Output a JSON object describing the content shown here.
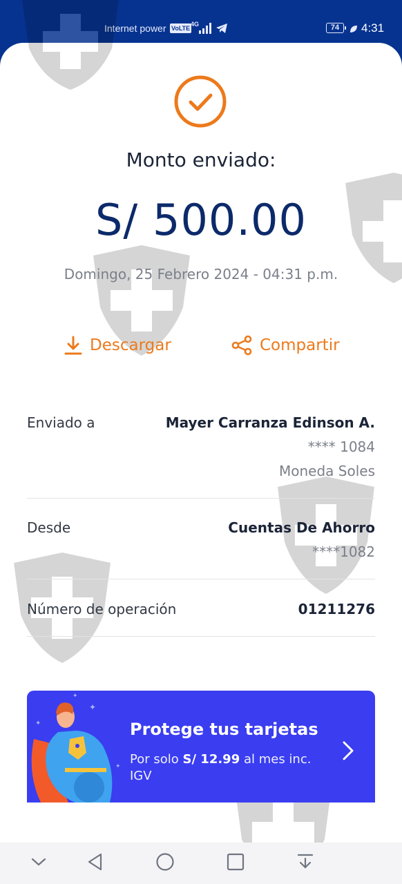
{
  "status_bar": {
    "carrier": "Internet power",
    "volte": "VoLTE",
    "network": "4G",
    "battery": "74",
    "time": "4:31"
  },
  "receipt": {
    "title": "Monto enviado:",
    "amount": "S/ 500.00",
    "datetime": "Domingo, 25 Febrero 2024 - 04:31 p.m."
  },
  "actions": {
    "download": "Descargar",
    "share": "Compartir"
  },
  "details": {
    "sent_to": {
      "label": "Enviado a",
      "name": "Mayer Carranza Edinson A.",
      "account": "**** 1084",
      "currency": "Moneda Soles"
    },
    "from": {
      "label": "Desde",
      "account_type": "Cuentas De Ahorro",
      "account": "****1082"
    },
    "operation": {
      "label": "Número de operación",
      "number": "01211276"
    }
  },
  "promo": {
    "title": "Protege tus tarjetas",
    "desc_prefix": "Por solo ",
    "price": "S/ 12.99",
    "desc_suffix": " al mes inc. IGV"
  },
  "colors": {
    "brand_blue": "#06338f",
    "accent_orange": "#ec7a1c",
    "promo_blue": "#3a3df0"
  }
}
